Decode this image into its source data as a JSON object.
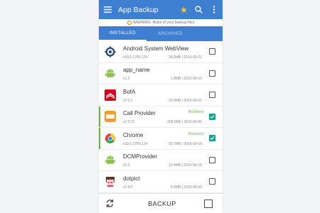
{
  "appbar": {
    "title": "App Backup",
    "menu_icon": "menu-icon",
    "star_icon": "star-icon",
    "search_icon": "search-icon",
    "more_icon": "more-vert-icon"
  },
  "warning": {
    "text": "WARNING: Risks of your backup files"
  },
  "tabs": [
    {
      "label": "INSTALLED",
      "active": true
    },
    {
      "label": "ARCHIVED",
      "active": false
    }
  ],
  "apps": [
    {
      "name": "Android System WebView",
      "version": "v53.0.2785.124",
      "size": "28.9MB",
      "date": "2016-09-21",
      "archived": "",
      "checked": false,
      "icon": "gear-icon"
    },
    {
      "name": "app_name",
      "version": "v1.2",
      "size": "1.8MB",
      "date": "2016-06-16",
      "archived": "",
      "checked": false,
      "icon": "android-icon"
    },
    {
      "name": "BofA",
      "version": "v7.0.2",
      "size": "30.9MB",
      "date": "2016-06-01",
      "archived": "",
      "checked": false,
      "icon": "bofa-icon"
    },
    {
      "name": "Call Provider",
      "version": "v2.0.21",
      "size": "268.6KB",
      "date": "2016-06-06",
      "archived": "Archived",
      "checked": true,
      "icon": "callprovider-icon"
    },
    {
      "name": "Chrome",
      "version": "v53.0.2785.124",
      "size": "59.7MB",
      "date": "2016-09-18",
      "archived": "Archived",
      "checked": true,
      "icon": "chrome-icon"
    },
    {
      "name": "DCMProvider",
      "version": "v2.0",
      "size": "10.4MB",
      "date": "2014-08-18",
      "archived": "",
      "checked": false,
      "icon": "android-icon"
    },
    {
      "name": "dotpict",
      "version": "v2.4.0",
      "size": "5.9MB",
      "date": "2016-08-08",
      "archived": "",
      "checked": false,
      "icon": "dotpict-icon"
    },
    {
      "name": "",
      "version": "",
      "size": "",
      "date": "",
      "archived": "",
      "checked": false,
      "icon": "app-icon"
    }
  ],
  "bottombar": {
    "refresh_icon": "refresh-icon",
    "backup_label": "BACKUP"
  },
  "colors": {
    "primary": "#3f7fd1",
    "accent_check": "#1a9e8f",
    "archived_green": "#66bb3f",
    "warning": "#e08a00",
    "star": "#f6cb23"
  }
}
